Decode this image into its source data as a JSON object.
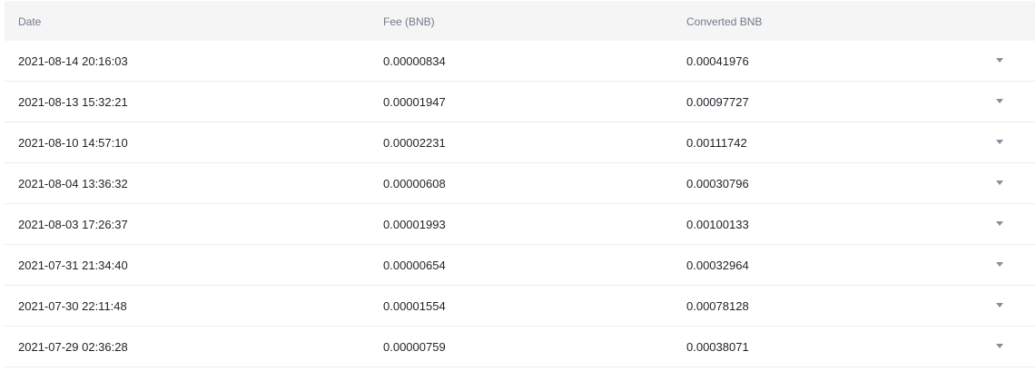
{
  "table": {
    "headers": {
      "date": "Date",
      "fee": "Fee (BNB)",
      "converted": "Converted BNB"
    },
    "rows": [
      {
        "date": "2021-08-14 20:16:03",
        "fee": "0.00000834",
        "converted": "0.00041976"
      },
      {
        "date": "2021-08-13 15:32:21",
        "fee": "0.00001947",
        "converted": "0.00097727"
      },
      {
        "date": "2021-08-10 14:57:10",
        "fee": "0.00002231",
        "converted": "0.00111742"
      },
      {
        "date": "2021-08-04 13:36:32",
        "fee": "0.00000608",
        "converted": "0.00030796"
      },
      {
        "date": "2021-08-03 17:26:37",
        "fee": "0.00001993",
        "converted": "0.00100133"
      },
      {
        "date": "2021-07-31 21:34:40",
        "fee": "0.00000654",
        "converted": "0.00032964"
      },
      {
        "date": "2021-07-30 22:11:48",
        "fee": "0.00001554",
        "converted": "0.00078128"
      },
      {
        "date": "2021-07-29 02:36:28",
        "fee": "0.00000759",
        "converted": "0.00038071"
      }
    ],
    "row_action_icon": "chevron-down-icon"
  }
}
